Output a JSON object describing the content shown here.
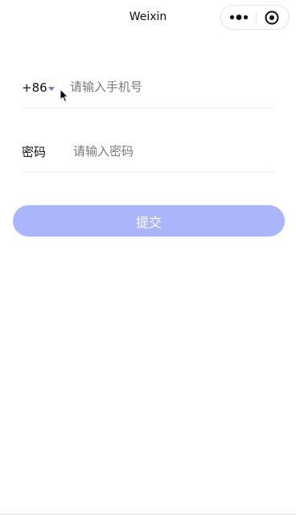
{
  "navbar": {
    "title": "Weixin",
    "menu_icon": "more-dots-icon",
    "close_icon": "target-circle-icon"
  },
  "form": {
    "country_code": "+86",
    "phone_placeholder": "请输入手机号",
    "phone_value": "",
    "password_label": "密码",
    "password_placeholder": "请输入密码",
    "password_value": ""
  },
  "submit": {
    "label": "提交"
  },
  "colors": {
    "submit_bg": "#aab5fb",
    "dropdown_arrow": "#6f7fae",
    "placeholder": "#7a7a7a"
  }
}
